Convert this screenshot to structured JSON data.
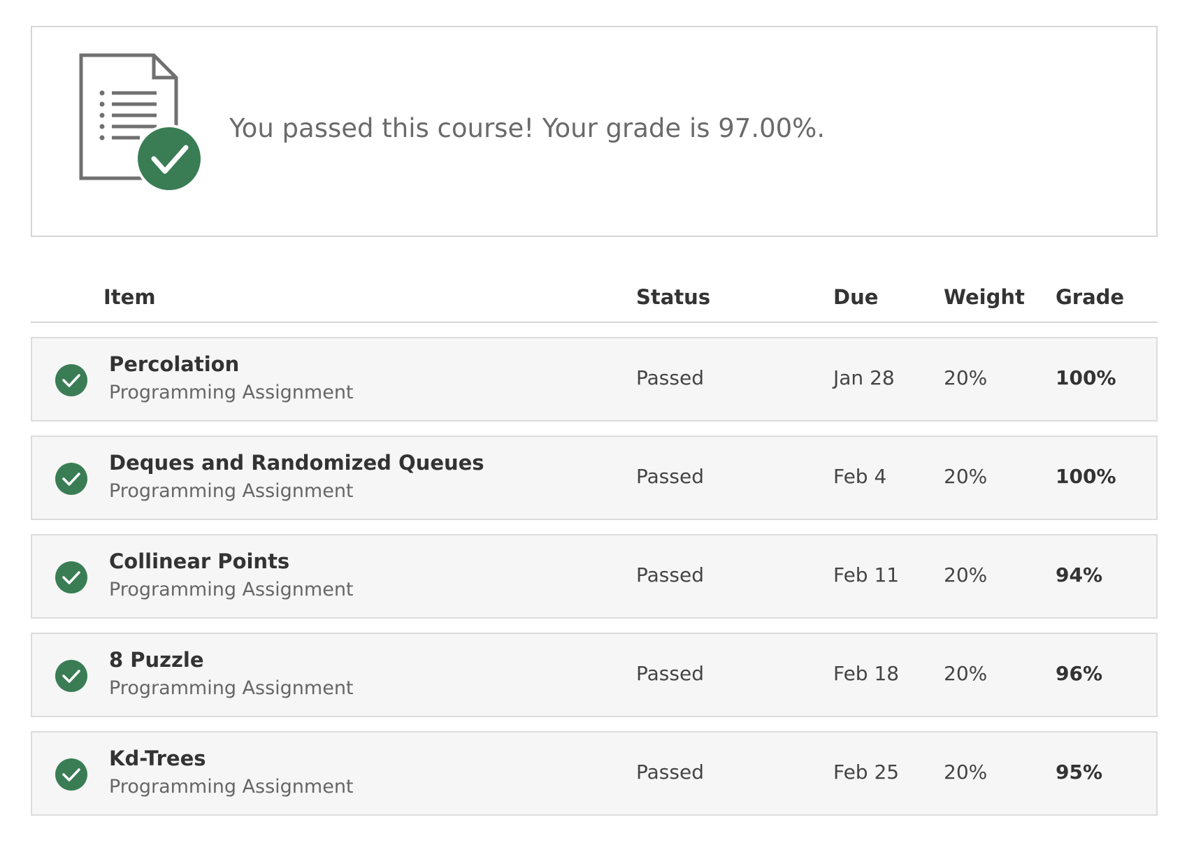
{
  "summary": {
    "message": "You passed this course! Your grade is 97.00%.",
    "icon": "document-check-icon",
    "accent_color": "#3a7d55"
  },
  "table": {
    "headers": {
      "item": "Item",
      "status": "Status",
      "due": "Due",
      "weight": "Weight",
      "grade": "Grade"
    },
    "rows": [
      {
        "title": "Percolation",
        "type": "Programming Assignment",
        "status": "Passed",
        "due": "Jan 28",
        "weight": "20%",
        "grade": "100%"
      },
      {
        "title": "Deques and Randomized Queues",
        "type": "Programming Assignment",
        "status": "Passed",
        "due": "Feb 4",
        "weight": "20%",
        "grade": "100%"
      },
      {
        "title": "Collinear Points",
        "type": "Programming Assignment",
        "status": "Passed",
        "due": "Feb 11",
        "weight": "20%",
        "grade": "94%"
      },
      {
        "title": "8 Puzzle",
        "type": "Programming Assignment",
        "status": "Passed",
        "due": "Feb 18",
        "weight": "20%",
        "grade": "96%"
      },
      {
        "title": "Kd-Trees",
        "type": "Programming Assignment",
        "status": "Passed",
        "due": "Feb 25",
        "weight": "20%",
        "grade": "95%"
      }
    ],
    "row_icon": "check-circle-icon"
  }
}
